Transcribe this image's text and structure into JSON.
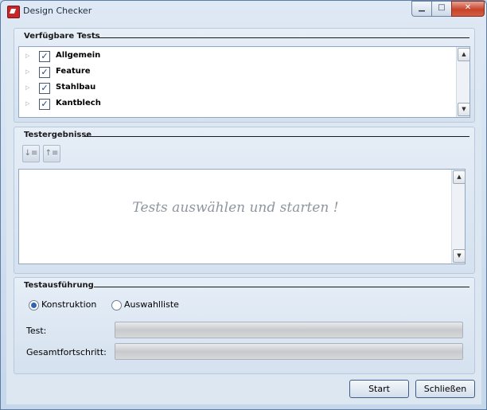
{
  "window": {
    "title": "Design Checker",
    "min_glyph": "▁",
    "max_glyph": "□",
    "close_glyph": "✕"
  },
  "tests": {
    "title": "Verfügbare Tests",
    "items": [
      {
        "label": "Allgemein",
        "checked": true
      },
      {
        "label": "Feature",
        "checked": true
      },
      {
        "label": "Stahlbau",
        "checked": true
      },
      {
        "label": "Kantblech",
        "checked": true
      }
    ]
  },
  "results": {
    "title": "Testergebnisse",
    "placeholder": "Tests auswählen und starten !",
    "expand_icon": "expand-all-icon",
    "collapse_icon": "collapse-all-icon"
  },
  "execution": {
    "title": "Testausführung",
    "options": [
      {
        "label": "Konstruktion",
        "selected": true
      },
      {
        "label": "Auswahlliste",
        "selected": false
      }
    ],
    "test_label": "Test:",
    "test_progress": 0,
    "overall_label": "Gesamtfortschritt:",
    "overall_progress": 0
  },
  "buttons": {
    "start": "Start",
    "close": "Schließen"
  },
  "colors": {
    "check": "#1b3f8c",
    "radio": "#2f62b5",
    "close_button": "#c7432b"
  }
}
